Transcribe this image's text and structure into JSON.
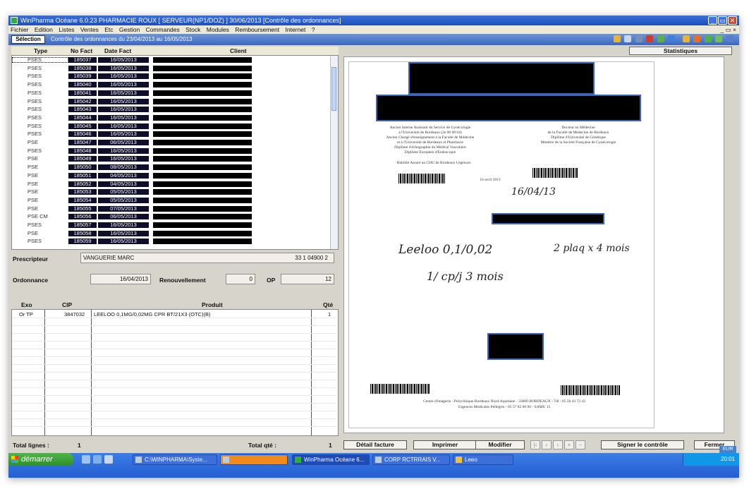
{
  "window": {
    "title": "WinPharma Océane 6.0.23   PHARMACIE ROUX [ SERVEUR(NP1/DOZ) ]   30/06/2013   [Contrôle des ordonnances]"
  },
  "menu": {
    "items": [
      "Fichier",
      "Edition",
      "Listes",
      "Ventes",
      "Etc",
      "Gestion",
      "Commandes",
      "Stock",
      "Modules",
      "Remboursement",
      "Internet",
      "?"
    ],
    "mdi_controls": "_ ▭ ×"
  },
  "toolbar": {
    "selection_label": "Sélection",
    "subtitle": "Contrôle des ordonnances du 23/04/2013 au 16/05/2013"
  },
  "invoice_grid": {
    "headers": {
      "type": "Type",
      "num": "No Fact",
      "date": "Date Fact",
      "client": "Client"
    },
    "rows": [
      {
        "type": "PSES",
        "num": "185037",
        "date": "16/05/2013"
      },
      {
        "type": "PSES",
        "num": "185038",
        "date": "16/05/2013"
      },
      {
        "type": "PSES",
        "num": "185039",
        "date": "16/05/2013"
      },
      {
        "type": "PSES",
        "num": "185040",
        "date": "16/05/2013"
      },
      {
        "type": "PSES",
        "num": "185041",
        "date": "16/05/2013"
      },
      {
        "type": "PSES",
        "num": "185042",
        "date": "16/05/2013"
      },
      {
        "type": "PSES",
        "num": "185043",
        "date": "16/05/2013"
      },
      {
        "type": "PSES",
        "num": "185044",
        "date": "16/05/2013"
      },
      {
        "type": "PSES",
        "num": "185045",
        "date": "16/05/2013"
      },
      {
        "type": "PSES",
        "num": "185046",
        "date": "16/05/2013"
      },
      {
        "type": "PSE",
        "num": "185047",
        "date": "06/05/2013"
      },
      {
        "type": "PSES",
        "num": "185048",
        "date": "16/05/2013"
      },
      {
        "type": "PSE",
        "num": "185049",
        "date": "16/05/2013"
      },
      {
        "type": "PSE",
        "num": "185050",
        "date": "08/05/2013"
      },
      {
        "type": "PSE",
        "num": "185051",
        "date": "04/05/2013"
      },
      {
        "type": "PSE",
        "num": "185052",
        "date": "04/05/2013"
      },
      {
        "type": "PSE",
        "num": "185053",
        "date": "05/05/2013"
      },
      {
        "type": "PSE",
        "num": "185054",
        "date": "05/05/2013"
      },
      {
        "type": "PSE",
        "num": "185055",
        "date": "07/05/2013"
      },
      {
        "type": "PSE CM",
        "num": "185056",
        "date": "06/05/2013"
      },
      {
        "type": "PSES",
        "num": "185057",
        "date": "16/05/2013"
      },
      {
        "type": "PSE",
        "num": "185058",
        "date": "16/05/2013"
      },
      {
        "type": "PSES",
        "num": "185059",
        "date": "16/05/2013"
      }
    ]
  },
  "prescription": {
    "prescripteur_label": "Prescripteur",
    "prescripteur_value": "VANGUERIE MARC",
    "prescripteur_id": "33 1 04900 2",
    "ordonnance_label": "Ordonnance",
    "ordonnance_value": "16/04/2013",
    "renouvellement_label": "Renouvellement",
    "renouvellement_value": "0",
    "op_label": "OP",
    "op_value": "12"
  },
  "product_grid": {
    "headers": {
      "exo": "Exo",
      "cip": "CIP",
      "produit": "Produit",
      "qte": "Qté"
    },
    "rows": [
      {
        "exo": "Or TP",
        "cip": "3847032",
        "produit": "LEELOO 0,1MG/0,02MG CPR BT/21X3 (OTC)(B)",
        "qte": "1"
      }
    ]
  },
  "totals": {
    "lines_label": "Total lignes :",
    "lines_value": "1",
    "qty_label": "Total qté :",
    "qty_value": "1"
  },
  "document": {
    "statistiques_label": "Statistiques",
    "header_left": [
      "Ancien Interne Assistant du Service de Gynécologie",
      "à l'Université de Bordeaux (2e 00 08 04)",
      "Ancien Chargé d'enseignement à la Faculté de Médecine",
      "et à l'Université de Bordeaux et Pharmacie",
      "Diplômé d'échographie du Médical Vasculaire",
      "Diplôme Européen d'Endoscopie"
    ],
    "header_right": [
      "Docteur en Médecine",
      "de la Faculté de Médecine de Bordeaux",
      "Diplôme d'Université de Génétique",
      "Membre de la Société Française de Gynécologie"
    ],
    "mid_line": "Habilité Assuré au CHU de Bordeaux Urgences",
    "doc_date_label": "16 avril 2013",
    "handwriting": [
      "16/04/13",
      "Leeloo 0,1/0,02",
      "1/ cp/j 3 mois",
      "2 plaq x 4 mois"
    ],
    "footer_line": "Centre d'imagerie - Polyclinique Bordeaux Nord-Aquitaine - 33000 BORDEAUX - Tél : 05 56 43 72 43",
    "footer_line2": "Urgences Médicales Pellegrin - 05 57 82 00 00 - SAMU 15"
  },
  "buttons": {
    "detail": "Détail facture",
    "imprimer": "Imprimer",
    "modifier": "Modifier",
    "signer": "Signer le contrôle",
    "fermer": "Fermer"
  },
  "status": {
    "currency": "EUR"
  },
  "taskbar": {
    "start_label": "démarrer",
    "tasks": [
      "C:\\WINPHARMA\\Syste...",
      "",
      "WinPharma Océane 6...",
      "CORP RCTRRAIS V...",
      "Leeo"
    ],
    "clock": "20:01"
  },
  "colors": {
    "titlebar": "#1f4fb8",
    "selection_dark": "#0e0e2a",
    "redaction_border": "#3c65b5",
    "start_button": "#2e8f2b"
  }
}
